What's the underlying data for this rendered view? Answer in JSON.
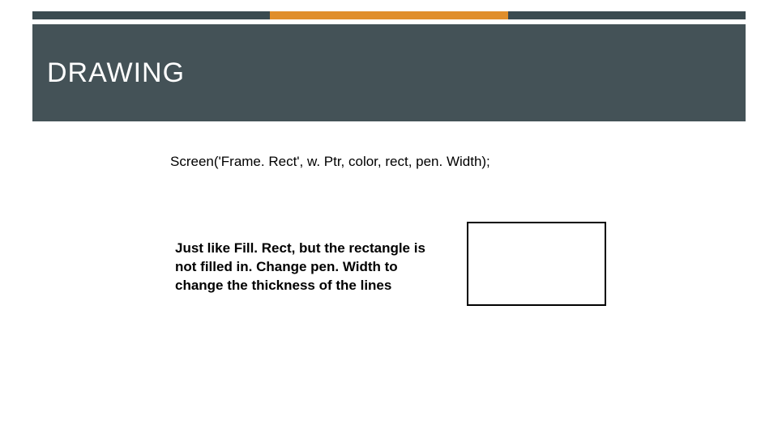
{
  "header": {
    "title": "DRAWING"
  },
  "content": {
    "code_line": "Screen('Frame. Rect', w. Ptr, color, rect, pen. Width);",
    "description": "Just like Fill. Rect, but the rectangle is not filled in.  Change pen. Width to change the thickness of the lines"
  }
}
